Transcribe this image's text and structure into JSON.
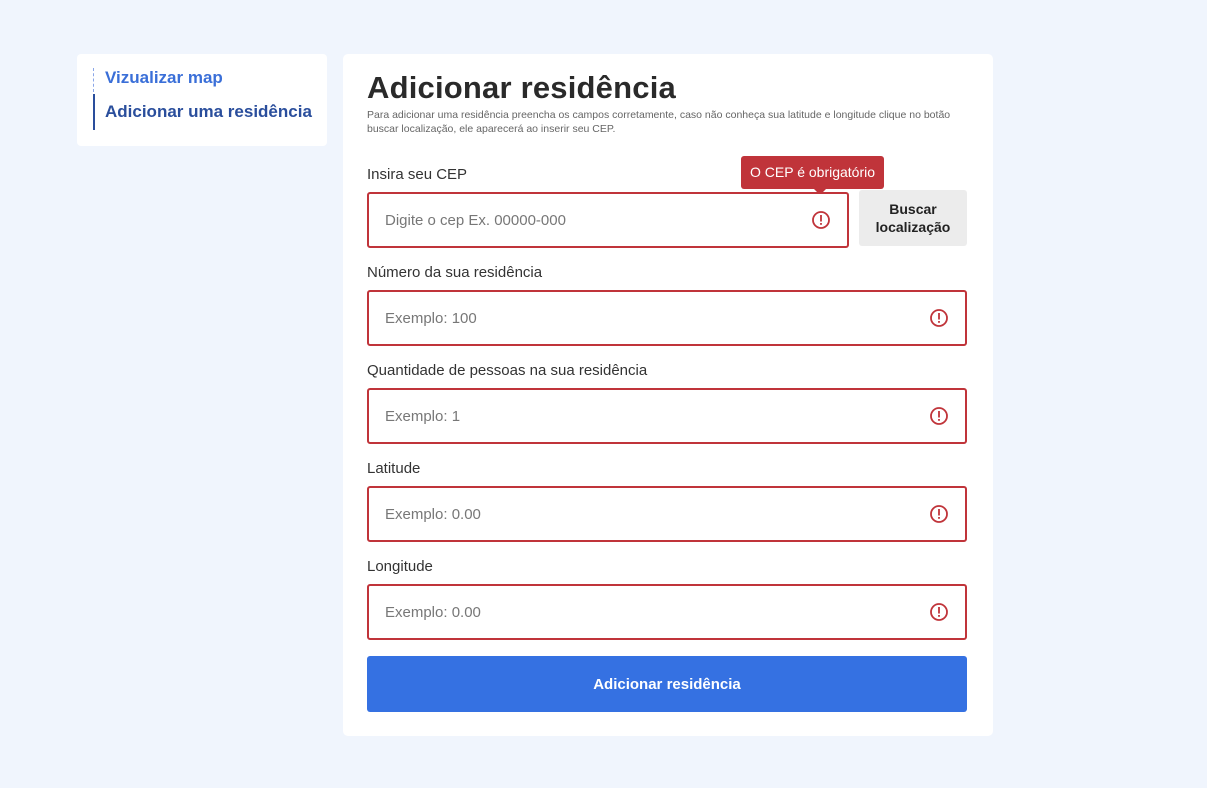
{
  "sidebar": {
    "items": [
      {
        "label": "Vizualizar map"
      },
      {
        "label": "Adicionar uma residência"
      }
    ]
  },
  "form": {
    "title": "Adicionar residência",
    "description": "Para adicionar uma residência preencha os campos corretamente, caso não conheça sua latitude e longitude clique no botão buscar localização, ele aparecerá ao inserir seu CEP.",
    "cep": {
      "label": "Insira seu CEP",
      "placeholder": "Digite o cep Ex. 00000-000",
      "error": "O CEP é obrigatório"
    },
    "buscar_label": "Buscar localização",
    "numero": {
      "label": "Número da sua residência",
      "placeholder": "Exemplo: 100"
    },
    "pessoas": {
      "label": "Quantidade de pessoas na sua residência",
      "placeholder": "Exemplo: 1"
    },
    "latitude": {
      "label": "Latitude",
      "placeholder": "Exemplo: 0.00"
    },
    "longitude": {
      "label": "Longitude",
      "placeholder": "Exemplo: 0.00"
    },
    "submit_label": "Adicionar residência"
  },
  "colors": {
    "background": "#f0f5fd",
    "error": "#c0343a",
    "primary": "#3571e2",
    "nav_link": "#3a6fd8",
    "nav_active": "#2a4e9c"
  },
  "icons": {
    "field_error": "warning-circle-icon"
  }
}
